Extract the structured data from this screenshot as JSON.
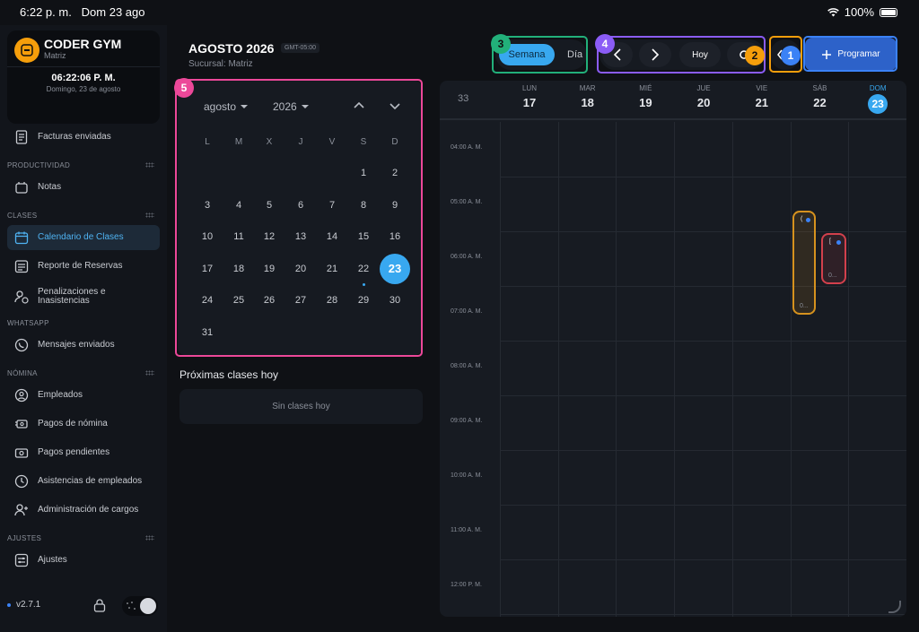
{
  "status": {
    "time": "6:22 p. m.",
    "date": "Dom 23 ago",
    "battery": "100%"
  },
  "gym": {
    "name": "CODER GYM",
    "branch": "Matriz",
    "clock": "06:22:06 P. M.",
    "date_long": "Domingo, 23 de agosto"
  },
  "sidebar": {
    "facturas": "Facturas enviadas",
    "sec_productividad": "PRODUCTIVIDAD",
    "notas": "Notas",
    "sec_clases": "CLASES",
    "calendario": "Calendario de Clases",
    "reporte": "Reporte de Reservas",
    "penalizaciones": "Penalizaciones e Inasistencias",
    "sec_whatsapp": "WHATSAPP",
    "mensajes": "Mensajes enviados",
    "sec_nomina": "NÓMINA",
    "empleados": "Empleados",
    "pagos_nomina": "Pagos de nómina",
    "pagos_pendientes": "Pagos pendientes",
    "asistencias": "Asistencias de empleados",
    "cargos": "Administración de cargos",
    "sec_ajustes": "AJUSTES",
    "ajustes": "Ajustes",
    "version": "v2.7.1"
  },
  "header": {
    "title": "AGOSTO 2026",
    "timezone": "GMT-05:00",
    "subtitle": "Sucursal: Matriz"
  },
  "mini_calendar": {
    "month": "agosto",
    "year": "2026",
    "weekdays": [
      "L",
      "M",
      "X",
      "J",
      "V",
      "S",
      "D"
    ],
    "rows": [
      [
        "",
        "",
        "",
        "",
        "",
        "1",
        "2"
      ],
      [
        "3",
        "4",
        "5",
        "6",
        "7",
        "8",
        "9"
      ],
      [
        "10",
        "11",
        "12",
        "13",
        "14",
        "15",
        "16"
      ],
      [
        "17",
        "18",
        "19",
        "20",
        "21",
        "22",
        "23"
      ],
      [
        "24",
        "25",
        "26",
        "27",
        "28",
        "29",
        "30"
      ],
      [
        "31",
        "",
        "",
        "",
        "",
        "",
        ""
      ]
    ],
    "today": "23",
    "marked": "22"
  },
  "upcoming": {
    "title": "Próximas clases hoy",
    "empty": "Sin clases hoy"
  },
  "toolbar": {
    "view_week": "Semana",
    "view_day": "Día",
    "today": "Hoy",
    "schedule": "Programar"
  },
  "annotations": [
    "1",
    "2",
    "3",
    "4",
    "5"
  ],
  "week": {
    "number": "33",
    "days": [
      {
        "dow": "LUN",
        "dom": "17"
      },
      {
        "dow": "MAR",
        "dom": "18"
      },
      {
        "dow": "MIÉ",
        "dom": "19"
      },
      {
        "dow": "JUE",
        "dom": "20"
      },
      {
        "dow": "VIE",
        "dom": "21"
      },
      {
        "dow": "SÁB",
        "dom": "22"
      },
      {
        "dow": "DOM",
        "dom": "23"
      }
    ],
    "hours": [
      "04:00 A. M.",
      "05:00 A. M.",
      "06:00 A. M.",
      "07:00 A. M.",
      "08:00 A. M.",
      "09:00 A. M.",
      "10:00 A. M.",
      "11:00 A. M.",
      "12:00 P. M."
    ],
    "events": [
      {
        "day": "SÁB",
        "title": "(",
        "sub": "0...",
        "color": "#d6921e"
      },
      {
        "day": "SÁB",
        "title": "[",
        "sub": "0...",
        "color": "#d2404c"
      }
    ]
  },
  "colors": {
    "accent": "#38a8f0",
    "primary_button": "#2d62c9",
    "ann1": "#3b82f6",
    "ann2": "#f59e0b",
    "ann3": "#22b07a",
    "ann4": "#8b5cf6",
    "ann5": "#ec4899"
  }
}
